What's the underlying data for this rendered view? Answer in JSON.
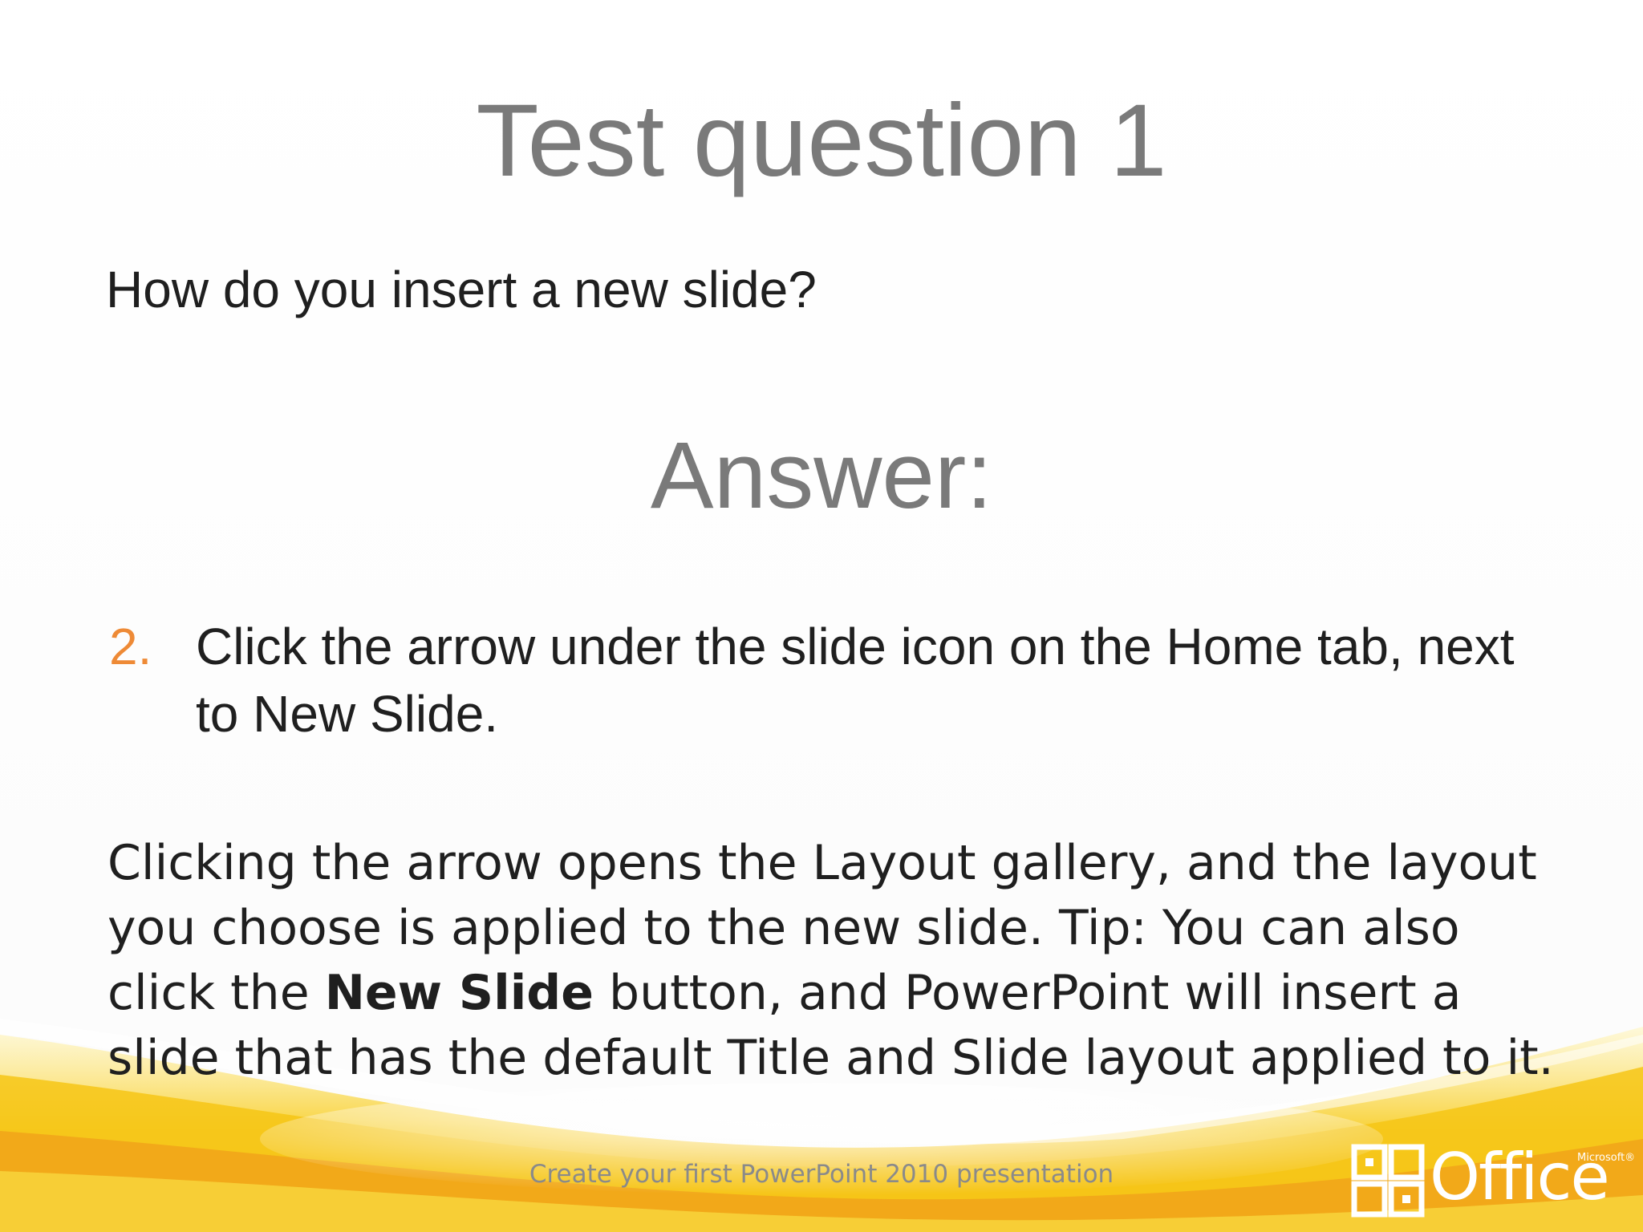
{
  "slide": {
    "title": "Test question 1",
    "question": "How do you insert a new slide?",
    "answer_heading": "Answer:",
    "answer": {
      "number": "2.",
      "text": "Click the arrow under the slide icon on the Home tab, next to New Slide."
    },
    "explanation": {
      "part1": "Clicking the arrow opens the Layout gallery, and the layout you choose is applied to the new slide. Tip: You can also click the ",
      "bold": "New Slide",
      "part2": " button, and PowerPoint will insert a slide that has the default Title and Slide layout applied to it."
    },
    "footer": "Create your first PowerPoint 2010 presentation",
    "logo": {
      "text": "Office",
      "brand": "Microsoft®",
      "icon": "office-logo-icon"
    }
  },
  "colors": {
    "title": "#7a7a7a",
    "body": "#1f1f1f",
    "accent": "#ee8a36",
    "swoosh_yellow": "#f6c515",
    "swoosh_orange": "#f2a51a",
    "footer": "#8a8a8a"
  }
}
